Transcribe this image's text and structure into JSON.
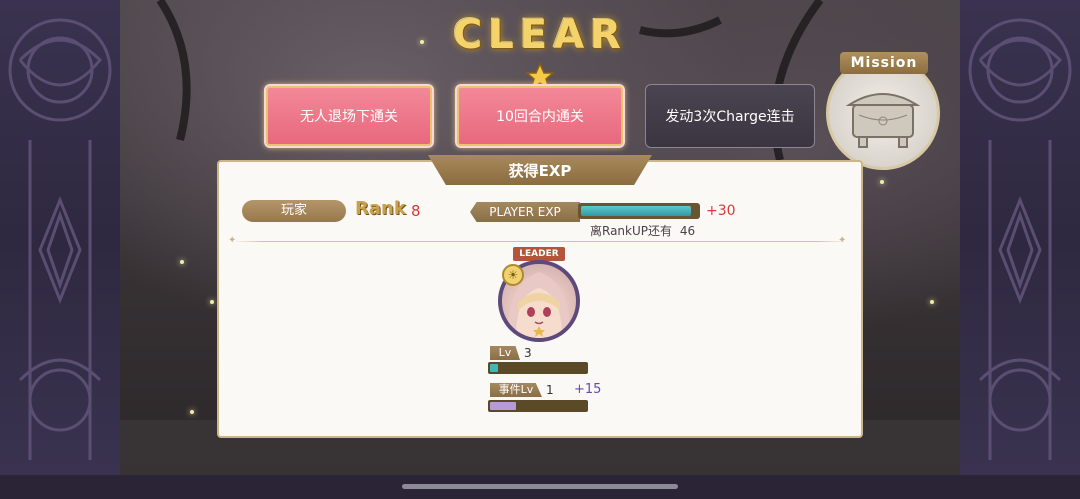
{
  "title": "CLEAR",
  "missions": [
    {
      "label": "无人退场下通关",
      "status": "complete"
    },
    {
      "label": "10回合内通关",
      "status": "complete"
    },
    {
      "label": "发动3次Charge连击",
      "status": "incomplete"
    }
  ],
  "mission_badge": {
    "label": "Mission"
  },
  "exp_panel": {
    "header": "获得EXP",
    "player_label": "玩家",
    "rank_label": "Rank",
    "rank_value": "8",
    "player_exp_label": "PLAYER EXP",
    "player_exp_fraction": 0.95,
    "player_exp_gain": "+30",
    "rankup_text": "离RankUP还有",
    "rankup_remaining": "46"
  },
  "character": {
    "leader_tag": "LEADER",
    "lv_label": "Lv",
    "lv_value": "3",
    "lv_fraction": 0.08,
    "event_lv_label": "事件Lv",
    "event_lv_value": "1",
    "event_lv_gain": "+15",
    "event_lv_fraction": 0.27
  },
  "colors": {
    "complete_mission": "#e8677c",
    "incomplete_mission": "#3a3540",
    "gold_text": "#f4d36a",
    "gain_red": "#d33a3a",
    "gain_purple": "#6b48b8"
  }
}
